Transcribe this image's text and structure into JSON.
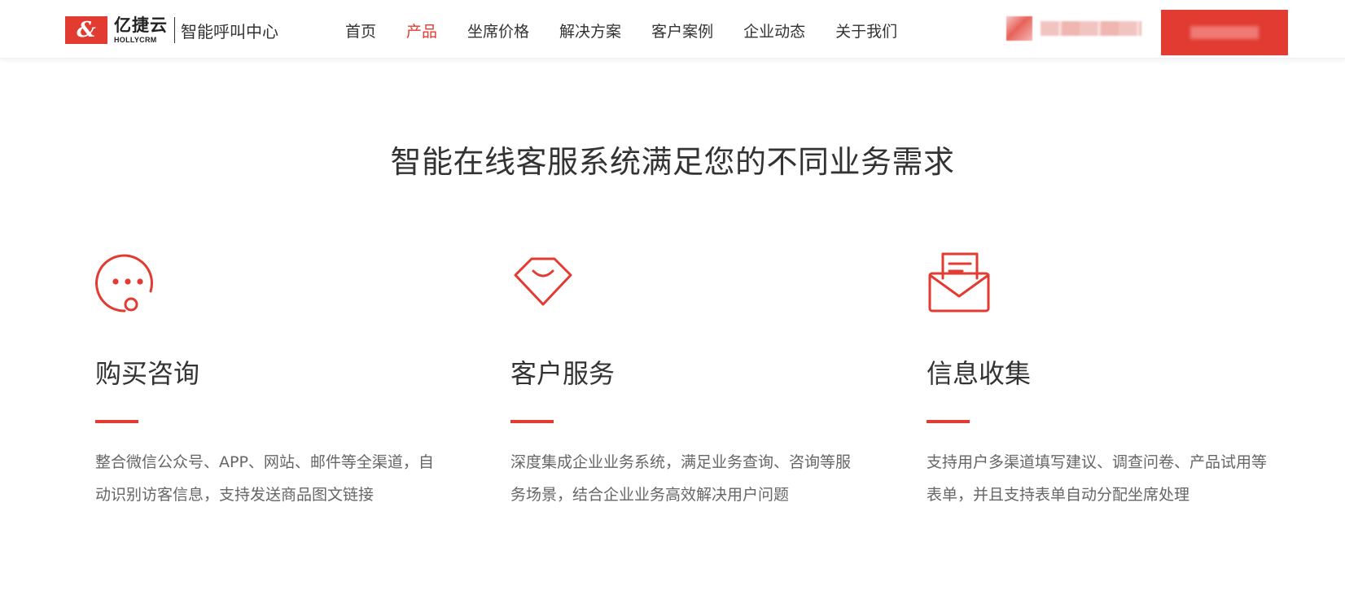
{
  "header": {
    "logo": {
      "mark": "&",
      "brand": "亿捷云",
      "sub": "HOLLYCRM",
      "tagline": "智能呼叫中心"
    },
    "nav": [
      {
        "label": "首页",
        "active": false
      },
      {
        "label": "产品",
        "active": true
      },
      {
        "label": "坐席价格",
        "active": false
      },
      {
        "label": "解决方案",
        "active": false
      },
      {
        "label": "客户案例",
        "active": false
      },
      {
        "label": "企业动态",
        "active": false
      },
      {
        "label": "关于我们",
        "active": false
      }
    ]
  },
  "main": {
    "title": "智能在线客服系统满足您的不同业务需求",
    "features": [
      {
        "icon": "chat-bubble-icon",
        "title": "购买咨询",
        "desc": "整合微信公众号、APP、网站、邮件等全渠道，自动识别访客信息，支持发送商品图文链接"
      },
      {
        "icon": "diamond-smile-icon",
        "title": "客户服务",
        "desc": "深度集成企业业务系统，满足业务查询、咨询等服务场景，结合企业业务高效解决用户问题"
      },
      {
        "icon": "envelope-letter-icon",
        "title": "信息收集",
        "desc": "支持用户多渠道填写建议、调查问卷、产品试用等表单，并且支持表单自动分配坐席处理"
      }
    ]
  },
  "colors": {
    "accent": "#e23b32",
    "text": "#333333",
    "muted": "#666666"
  }
}
